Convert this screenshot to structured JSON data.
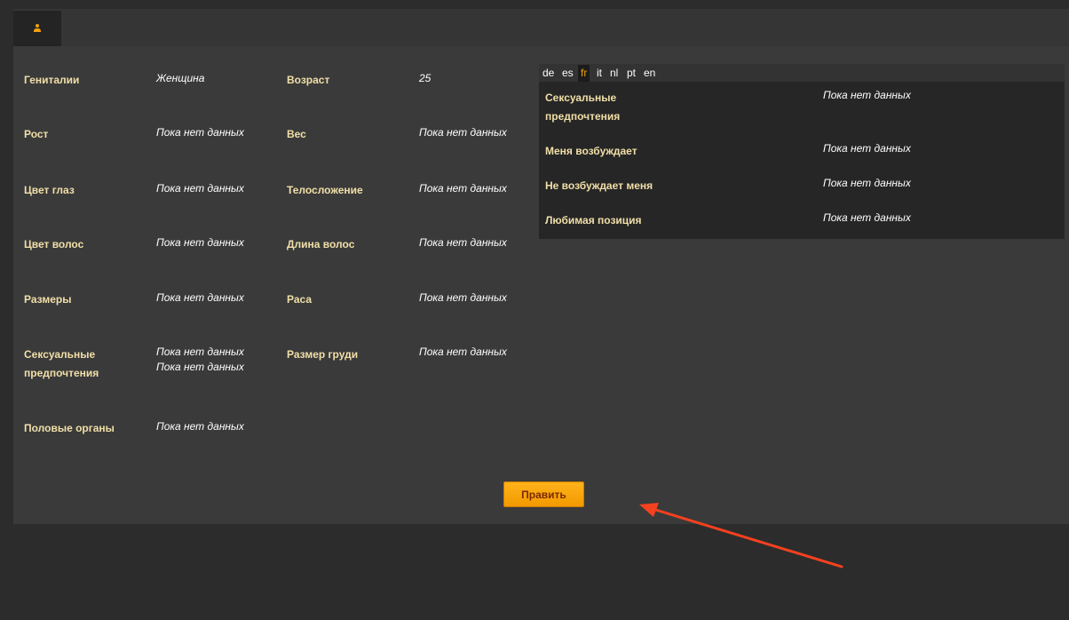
{
  "tabs": [
    {
      "icon": "user-icon",
      "active": true
    }
  ],
  "colors": {
    "label": "#f1dfa8",
    "value": "#ffffff",
    "accent": "#f3a10a",
    "button": "#ffa814",
    "annotation_arrow": "#f4411f"
  },
  "profile": {
    "col1": [
      {
        "label": "Гениталии",
        "value": "Женщина"
      },
      {
        "label": "Рост",
        "value": "Пока нет данных"
      },
      {
        "label": "Цвет глаз",
        "value": "Пока нет данных"
      },
      {
        "label": "Цвет волос",
        "value": "Пока нет данных"
      },
      {
        "label": "Размеры",
        "value": "Пока нет данных"
      },
      {
        "label_line1": "Сексуальные",
        "label_line2": "предпочтения",
        "value_line1": "Пока нет данных",
        "value_line2": "Пока нет данных"
      },
      {
        "label": "Половые органы",
        "value": "Пока нет данных"
      }
    ],
    "col2": [
      {
        "label": "Возраст",
        "value": "25"
      },
      {
        "label": "Вес",
        "value": "Пока нет данных"
      },
      {
        "label": "Телосложение",
        "value": "Пока нет данных"
      },
      {
        "label": "Длина волос",
        "value": "Пока нет данных"
      },
      {
        "label": "Раса",
        "value": "Пока нет данных"
      },
      {
        "label": "Размер груди",
        "value": "Пока нет данных"
      }
    ]
  },
  "languages": {
    "items": [
      "de",
      "es",
      "fr",
      "it",
      "nl",
      "pt",
      "en"
    ],
    "selected": "fr"
  },
  "preferences": [
    {
      "label_line1": "Сексуальные",
      "label_line2": "предпочтения",
      "value": "Пока нет данных"
    },
    {
      "label": "Меня возбуждает",
      "value": "Пока нет данных"
    },
    {
      "label": "Не возбуждает меня",
      "value": "Пока нет данных"
    },
    {
      "label": "Любимая позиция",
      "value": "Пока нет данных"
    }
  ],
  "edit_button": {
    "label": "Править"
  }
}
